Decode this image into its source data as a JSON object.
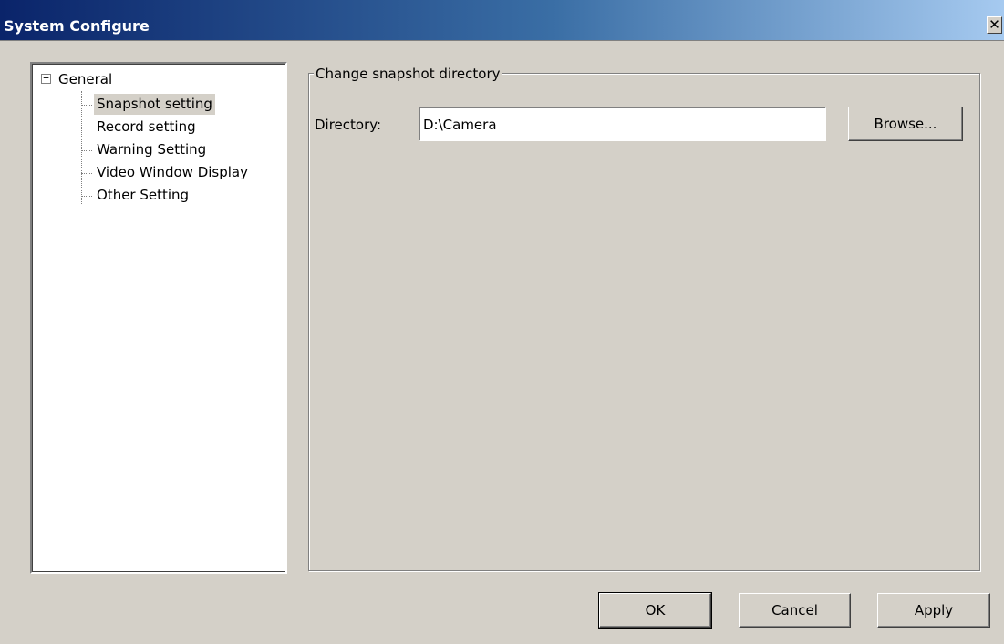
{
  "window": {
    "title": "System Configure",
    "close_glyph": "✕"
  },
  "tree": {
    "expander_glyph": "−",
    "root_label": "General",
    "items": [
      {
        "label": "Snapshot setting",
        "selected": true
      },
      {
        "label": "Record setting",
        "selected": false
      },
      {
        "label": "Warning Setting",
        "selected": false
      },
      {
        "label": "Video Window Display",
        "selected": false
      },
      {
        "label": "Other Setting",
        "selected": false
      }
    ]
  },
  "snapshot_group": {
    "legend": "Change snapshot directory",
    "directory_label": "Directory:",
    "directory_value": "D:\\Camera",
    "browse_label": "Browse..."
  },
  "footer": {
    "ok_label": "OK",
    "cancel_label": "Cancel",
    "apply_label": "Apply"
  }
}
